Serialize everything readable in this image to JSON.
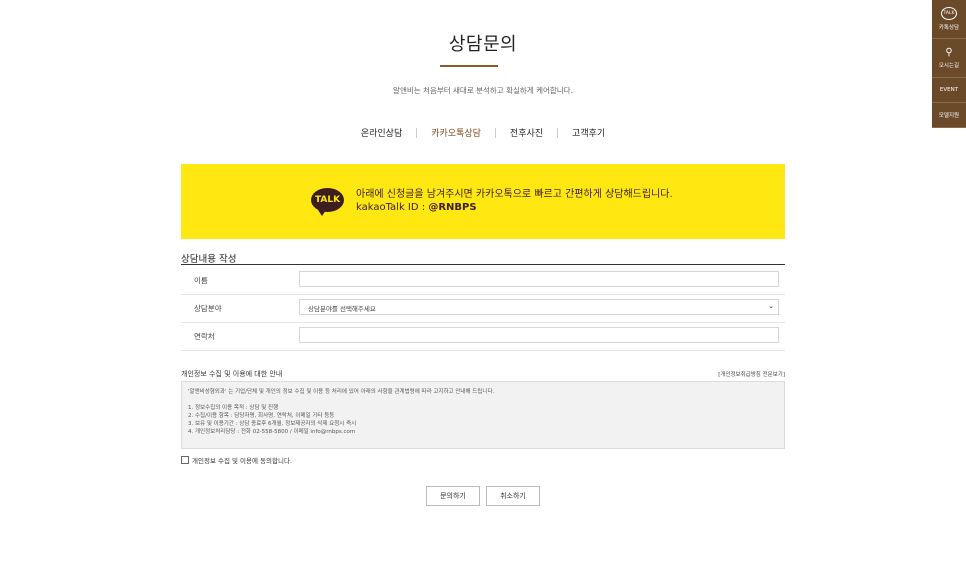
{
  "header": {
    "title": "상담문의",
    "subtitle": "알앤비는 처음부터 새대로 분석하고 확실하게 케어합니다."
  },
  "tabs": [
    {
      "label": "온라인상담"
    },
    {
      "label": "카카오톡상담"
    },
    {
      "label": "전후사진"
    },
    {
      "label": "고객후기"
    }
  ],
  "banner": {
    "icon_label": "TALK",
    "line1": "아래에 신청글을 남겨주시면 카카오톡으로 빠르고 간편하게 상담해드립니다.",
    "id_prefix": "kakaoTalk ID : ",
    "id_value": "@RNBPS"
  },
  "form": {
    "section_title": "상담내용 작성",
    "name_label": "이름",
    "name_value": "",
    "category_label": "상담분야",
    "category_selected": "상담분야를 선택해주세요",
    "contact_label": "연락처",
    "contact_value": ""
  },
  "privacy": {
    "title": "개인정보 수집 및 이용에 대한 안내",
    "link": "[개인정보취급방침 전문보기]",
    "intro": "'알앤비성형외과' 는 기업/단체 및 개인의 정보 수집 및 이용 등 처리에 있어 아래의 사항을 관계법령에 따라 고지하고 안내해 드립니다.",
    "items": [
      "1. 정보수집의 이용 목적 : 상담 및 진행",
      "2. 수집/이용 항목 : 담당자명, 회사명, 연락처, 이메일 기타 등등",
      "3. 보유 및 이용기간 : 상담 종료후 6개월, 정보제공자의 삭제 요청시 즉시",
      "4. 개인정보처리담당 : 전화 02-558-5800 / 이메일 info@rnbps.com"
    ],
    "agree_label": "개인정보 수집 및 이용에 동의합니다."
  },
  "buttons": {
    "submit": "문의하기",
    "cancel": "취소하기"
  },
  "side_nav": [
    {
      "icon": "talk-icon",
      "icon_text": "TALK",
      "label": "카톡상담"
    },
    {
      "icon": "location-icon",
      "icon_text": "⚲",
      "label": "오시는길"
    },
    {
      "icon": "",
      "icon_text": "",
      "label": "EVENT"
    },
    {
      "icon": "",
      "icon_text": "",
      "label": "모델지원"
    }
  ],
  "colors": {
    "banner_bg": "#ffe812",
    "talk_bubble": "#3c1e1e",
    "accent_brown": "#8a5a2b",
    "side_nav_bg": "#6b4a2a"
  }
}
